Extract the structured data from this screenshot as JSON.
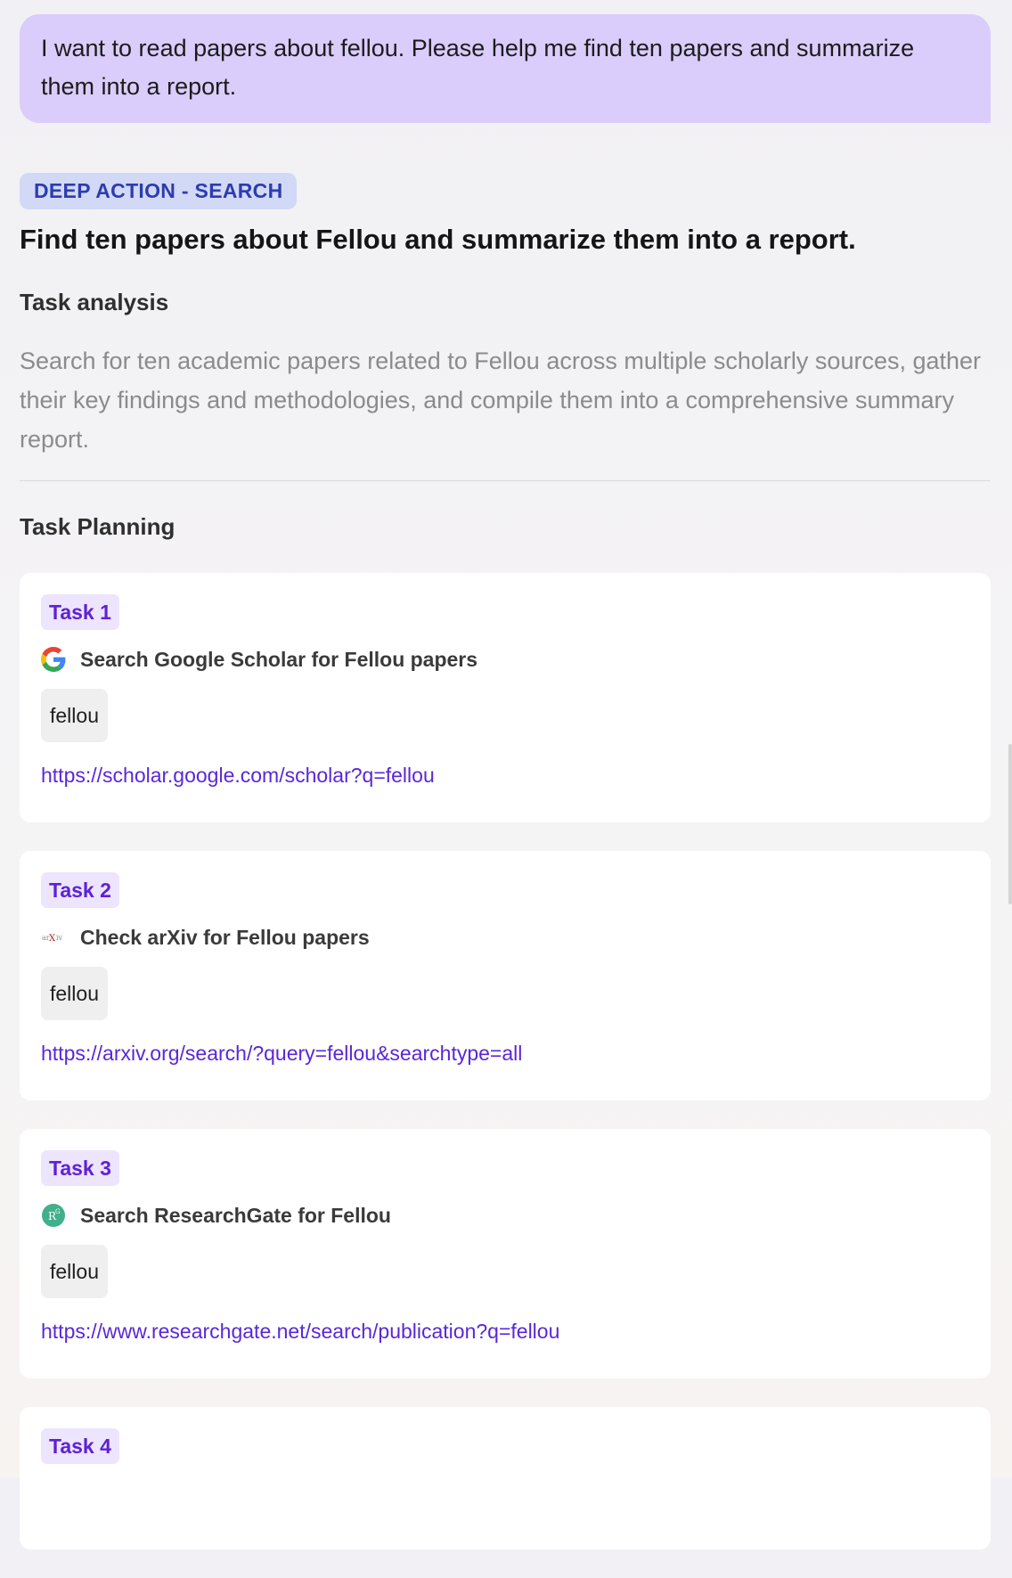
{
  "user_message": "I want to read papers about fellou. Please help me find ten papers and summarize them into a report.",
  "deep_action": {
    "badge": "DEEP ACTION - SEARCH",
    "title": "Find ten papers about Fellou and summarize them into a report."
  },
  "analysis": {
    "heading": "Task analysis",
    "text": "Search for ten academic papers related to Fellou across multiple scholarly sources, gather their key findings and methodologies, and compile them into a comprehensive summary report."
  },
  "planning": {
    "heading": "Task Planning",
    "tasks": [
      {
        "label": "Task 1",
        "icon": "google-icon",
        "name": "Search Google Scholar for Fellou papers",
        "query": "fellou",
        "url": "https://scholar.google.com/scholar?q=fellou"
      },
      {
        "label": "Task 2",
        "icon": "arxiv-icon",
        "name": "Check arXiv for Fellou papers",
        "query": "fellou",
        "url": "https://arxiv.org/search/?query=fellou&searchtype=all"
      },
      {
        "label": "Task 3",
        "icon": "researchgate-icon",
        "name": "Search ResearchGate for Fellou",
        "query": "fellou",
        "url": "https://www.researchgate.net/search/publication?q=fellou"
      },
      {
        "label": "Task 4"
      }
    ]
  },
  "colors": {
    "user_bubble": "#dacdfb",
    "deep_badge_bg": "#d2d9f6",
    "deep_badge_text": "#2d3cb0",
    "task_badge_bg": "#ede4fd",
    "task_badge_text": "#5d22d6",
    "link": "#5a27d8"
  }
}
